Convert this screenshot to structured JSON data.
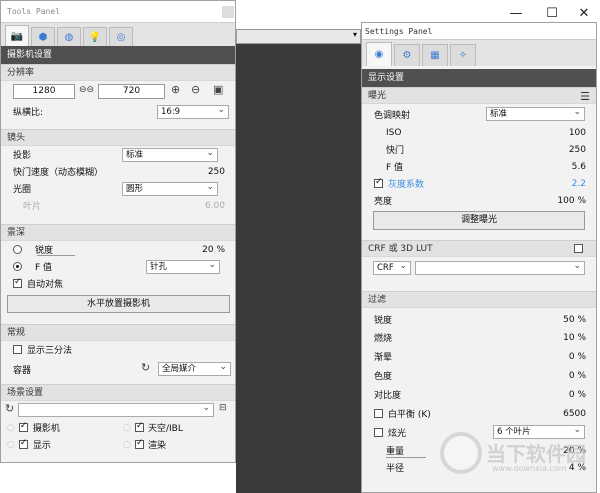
{
  "tools": {
    "title": "Tools Panel",
    "header": "摄影机设置",
    "resolution": {
      "section": "分辨率",
      "width": "1280",
      "height": "720",
      "aspect_label": "纵横比:",
      "aspect_value": "16:9"
    },
    "lens": {
      "section": "镜头",
      "projection_label": "投影",
      "projection_value": "标准",
      "shutter_label": "快门速度（动态模糊）",
      "shutter_value": "250",
      "aperture_label": "光圈",
      "aperture_value": "圆形",
      "blades_label": "叶片",
      "blades_value": "6.00"
    },
    "dof": {
      "section": "景深",
      "sharpness_label": "锐度",
      "sharpness_value": "20 %",
      "fvalue_label": "F 值",
      "fvalue_dd": "针孔",
      "autofocus_label": "自动对焦",
      "level_button": "水平放置摄影机"
    },
    "general": {
      "section": "常规",
      "thirds_label": "显示三分法",
      "container_label": "容器",
      "container_value": "全局媒介"
    },
    "scene": {
      "section": "场景设置",
      "camera_label": "摄影机",
      "sky_label": "天空/IBL",
      "display_label": "显示",
      "render_label": "渲染"
    }
  },
  "settings": {
    "title": "Settings Panel",
    "header": "显示设置",
    "exposure": {
      "section": "曝光",
      "tonemap_label": "色调映射",
      "tonemap_value": "标准",
      "iso_label": "ISO",
      "iso_value": "100",
      "shutter_label": "快门",
      "shutter_value": "250",
      "f_label": "F 值",
      "f_value": "5.6",
      "gamma_label": "灰度系数",
      "gamma_value": "2.2",
      "brightness_label": "亮度",
      "brightness_value": "100 %",
      "adjust_button": "调整曝光"
    },
    "crf": {
      "section": "CRF 或 3D LUT",
      "dd_value": "CRF"
    },
    "filter": {
      "section": "过滤",
      "sharpness_label": "锐度",
      "sharpness_value": "50 %",
      "burn_label": "燃烧",
      "burn_value": "10 %",
      "vignette_label": "渐晕",
      "vignette_value": "0 %",
      "saturation_label": "色度",
      "saturation_value": "0 %",
      "contrast_label": "对比度",
      "contrast_value": "0 %",
      "wb_label": "白平衡 (K)",
      "wb_value": "6500",
      "glare_label": "炫光",
      "glare_dd": "6 个叶片",
      "weight_label": "重量",
      "weight_value": "20 %",
      "radius_label": "半径",
      "radius_value": "4 %"
    }
  },
  "watermark": "当下软件园",
  "watermark_url": "www.downxia.com"
}
